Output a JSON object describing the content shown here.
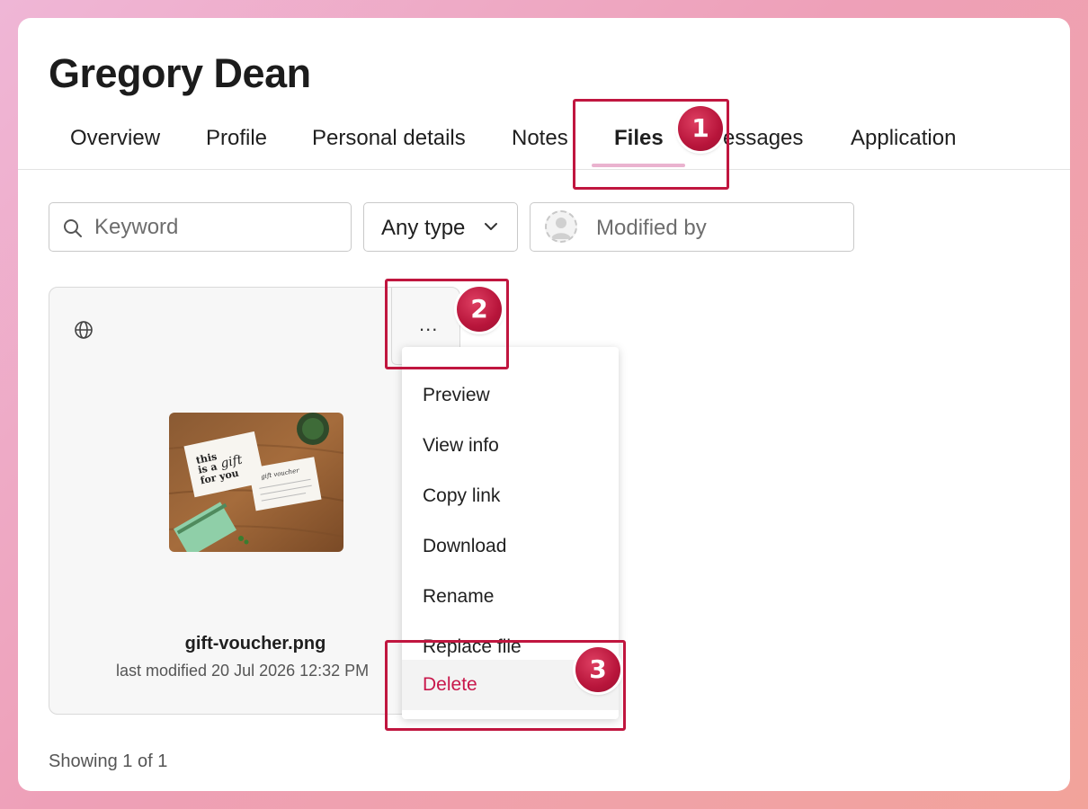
{
  "page": {
    "title": "Gregory Dean"
  },
  "tabs": [
    {
      "label": "Overview"
    },
    {
      "label": "Profile"
    },
    {
      "label": "Personal details"
    },
    {
      "label": "Notes"
    },
    {
      "label": "Files",
      "active": true
    },
    {
      "label": "Messages",
      "visible_text": "essages"
    },
    {
      "label": "Application"
    }
  ],
  "filters": {
    "keyword_placeholder": "Keyword",
    "type_value": "Any type",
    "modified_by_placeholder": "Modified by"
  },
  "file_card": {
    "name": "gift-voucher.png",
    "modified": "last modified 20 Jul 2026 12:32 PM",
    "more_label": "...",
    "thumbnail_text": [
      "this",
      "is a",
      "gift",
      "for you",
      "gift voucher"
    ]
  },
  "context_menu": {
    "items": [
      {
        "label": "Preview"
      },
      {
        "label": "View info"
      },
      {
        "label": "Copy link"
      },
      {
        "label": "Download"
      },
      {
        "label": "Rename"
      },
      {
        "label": "Replace file"
      },
      {
        "label": "Delete",
        "danger": true
      }
    ]
  },
  "footer": {
    "showing": "Showing 1 of 1"
  },
  "annotations": [
    {
      "number": "1",
      "target": "Files tab"
    },
    {
      "number": "2",
      "target": "More options button"
    },
    {
      "number": "3",
      "target": "Delete menu item"
    }
  ],
  "colors": {
    "accent_underline": "#eab3cf",
    "danger": "#c8174b",
    "annotation": "#c0163f"
  }
}
